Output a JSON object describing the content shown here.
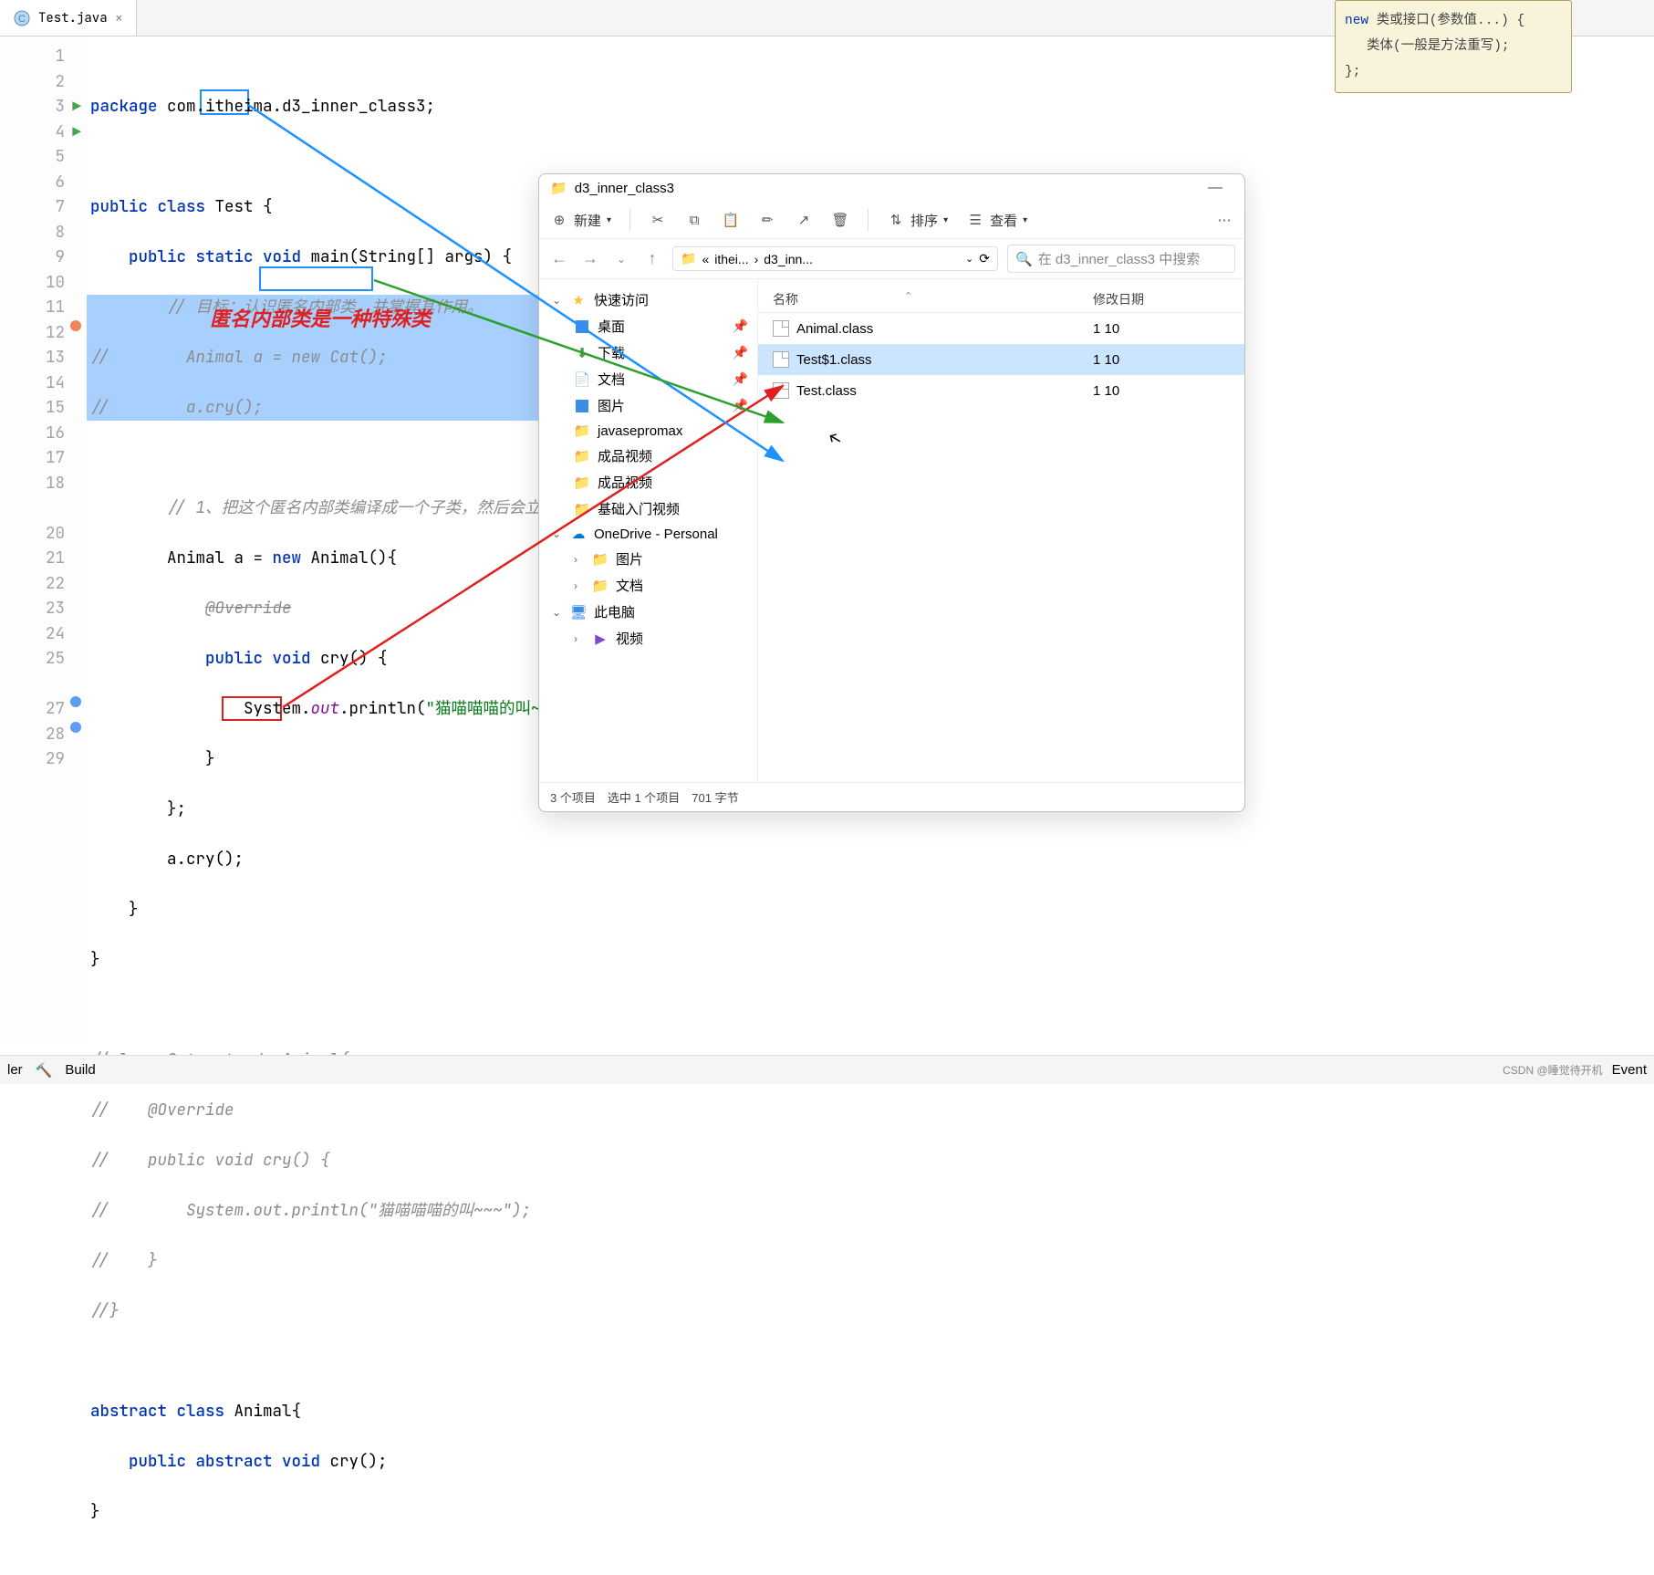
{
  "tab": {
    "filename": "Test.java"
  },
  "code": {
    "l1_pkg": "package ",
    "l1_rest": "com.itheima.d3_inner_class3;",
    "l3_a": "public class ",
    "l3_b": "Test",
    "l3_c": " {",
    "l4_a": "public static void ",
    "l4_b": "main",
    "l4_c": "(String[] args) {",
    "l5": "// 目标：认识匿名内部类，并掌握其作用。",
    "l6_a": "//        Animal a = new Cat();",
    "l7_a": "//        a.cry();",
    "l9": "// 1、把这个匿名内部类编译成一个子类，然后会立即创",
    "l10_a": "Animal a = ",
    "l10_b": "new ",
    "l10_c": "Animal()",
    "l10_d": "{",
    "l11": "@Override",
    "l12_a": "public void ",
    "l12_b": "cry()",
    "l12_c": " {",
    "l13_a": "System.",
    "l13_b": "out",
    "l13_c": ".println(",
    "l13_d": "\"猫喵喵喵的叫~~~\"",
    "l13_e": ");",
    "l14": "}",
    "l15": "};",
    "l16": "a.cry();",
    "l17": "}",
    "l18": "}",
    "l20": "//class Cat extends Animal{",
    "l21": "//    @Override",
    "l22": "//    public void cry() {",
    "l23": "//        System.out.println(\"猫喵喵喵的叫~~~\");",
    "l24": "//    }",
    "l25": "//}",
    "l27_a": "abstract class ",
    "l27_b": "Animal",
    "l27_c": "{",
    "l28_a": "public abstract void ",
    "l28_b": "cry()",
    "l28_c": ";",
    "l29": "}"
  },
  "annotation": "匿名内部类是一种特殊类",
  "tooltip": {
    "l1a": "new",
    "l1b": " 类或接口(参数值...) {",
    "l2": "类体(一般是方法重写);",
    "l3": "};"
  },
  "explorer": {
    "title": "d3_inner_class3",
    "new_btn": "新建",
    "sort_btn": "排序",
    "view_btn": "查看",
    "breadcrumb1": "ithei...",
    "breadcrumb2": "d3_inn...",
    "search_placeholder": "在 d3_inner_class3 中搜索",
    "tree": {
      "quick": "快速访问",
      "desktop": "桌面",
      "downloads": "下载",
      "documents": "文档",
      "pictures": "图片",
      "javasepromax": "javasepromax",
      "video1": "成品视频",
      "video2": "成品视频",
      "basic": "基础入门视频",
      "onedrive": "OneDrive - Personal",
      "od_pics": "图片",
      "od_docs": "文档",
      "thispc": "此电脑",
      "pc_video": "视频"
    },
    "headers": {
      "name": "名称",
      "date": "修改日期"
    },
    "files": [
      {
        "name": "Animal.class",
        "date": "1 10"
      },
      {
        "name": "Test$1.class",
        "date": "1 10"
      },
      {
        "name": "Test.class",
        "date": "1 10"
      }
    ],
    "status": "3 个项目　选中 1 个项目　701 字节"
  },
  "bottom": {
    "ler": "ler",
    "build": "Build",
    "event": "Event",
    "watermark": "CSDN @睡觉待开机"
  }
}
